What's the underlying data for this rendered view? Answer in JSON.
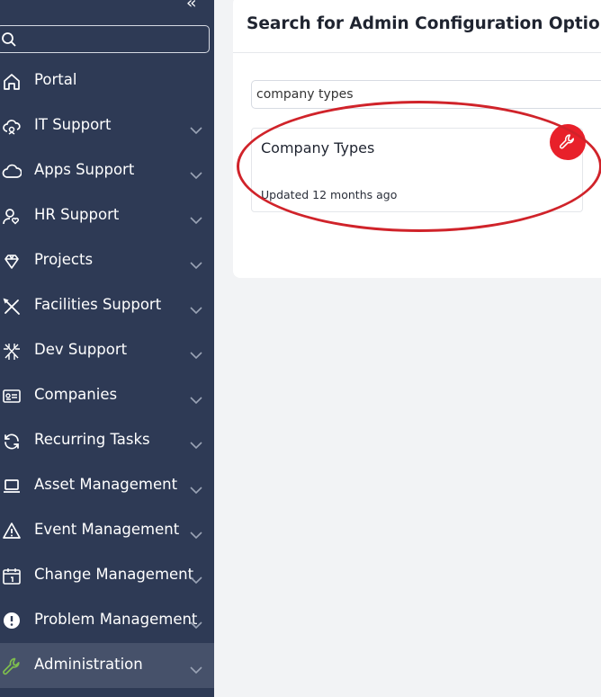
{
  "sidebar": {
    "collapse_icon": "double-chevron-left-icon",
    "search": {
      "value": "",
      "placeholder": ""
    },
    "items": [
      {
        "label": "Portal",
        "icon": "home-icon",
        "has_chevron": false
      },
      {
        "label": "IT Support",
        "icon": "cloud-support-icon",
        "has_chevron": true
      },
      {
        "label": "Apps Support",
        "icon": "cloud-icon",
        "has_chevron": true
      },
      {
        "label": "HR Support",
        "icon": "user-heart-icon",
        "has_chevron": true
      },
      {
        "label": "Projects",
        "icon": "diamond-icon",
        "has_chevron": true
      },
      {
        "label": "Facilities Support",
        "icon": "tools-icon",
        "has_chevron": true
      },
      {
        "label": "Dev Support",
        "icon": "bug-icon",
        "has_chevron": true
      },
      {
        "label": "Companies",
        "icon": "id-card-icon",
        "has_chevron": true
      },
      {
        "label": "Recurring Tasks",
        "icon": "refresh-icon",
        "has_chevron": true
      },
      {
        "label": "Asset Management",
        "icon": "laptop-icon",
        "has_chevron": true
      },
      {
        "label": "Event Management",
        "icon": "warning-icon",
        "has_chevron": true
      },
      {
        "label": "Change Management",
        "icon": "calendar-icon",
        "has_chevron": true
      },
      {
        "label": "Problem Management",
        "icon": "alert-circle-icon",
        "has_chevron": true
      },
      {
        "label": "Administration",
        "icon": "wrench-icon",
        "has_chevron": true,
        "active": true
      }
    ]
  },
  "main": {
    "title": "Search for Admin Configuration Options",
    "filter": {
      "value": "company types"
    },
    "results": [
      {
        "title": "Company Types",
        "updated": "Updated 12 months ago",
        "badge_icon": "wrench-icon"
      }
    ]
  },
  "colors": {
    "sidebar_bg": "#2e3a55",
    "sidebar_active_bg": "#46516a",
    "accent_green": "#7fbf4d",
    "badge_red": "#e8202a",
    "highlight_red": "#d0232a"
  }
}
